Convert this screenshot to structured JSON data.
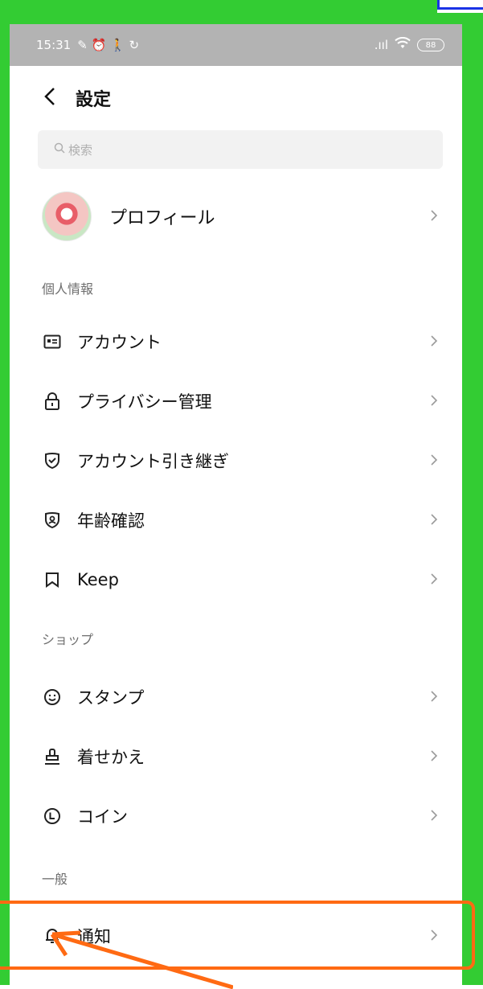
{
  "status_bar": {
    "time": "15:31",
    "left_icons": "✎ ⏰ 🚶 ↻",
    "signal": ".ııl",
    "wifi": "📶",
    "battery": "88"
  },
  "header": {
    "back_label": "<",
    "title": "設定"
  },
  "search": {
    "placeholder": "検索"
  },
  "profile": {
    "label": "プロフィール"
  },
  "sections": {
    "personal": "個人情報",
    "shop": "ショップ",
    "general": "一般"
  },
  "personal_items": [
    {
      "label": "アカウント",
      "icon": "id-card-icon",
      "glyph": "▤"
    },
    {
      "label": "プライバシー管理",
      "icon": "lock-icon",
      "glyph": "🔒"
    },
    {
      "label": "アカウント引き継ぎ",
      "icon": "shield-check-icon",
      "glyph": "🛡"
    },
    {
      "label": "年齢確認",
      "icon": "id-shield-icon",
      "glyph": "◎"
    },
    {
      "label": "Keep",
      "icon": "bookmark-icon",
      "glyph": "⌑"
    }
  ],
  "shop_items": [
    {
      "label": "スタンプ",
      "icon": "smile-icon",
      "glyph": "☺"
    },
    {
      "label": "着せかえ",
      "icon": "brush-icon",
      "glyph": "⚲"
    },
    {
      "label": "コイン",
      "icon": "coin-icon",
      "glyph": "◔"
    }
  ],
  "general_items": [
    {
      "label": "通知",
      "icon": "bell-icon",
      "glyph": "🔔"
    }
  ],
  "colors": {
    "frame": "#33cc33",
    "highlight": "#ff6a13",
    "statusbar": "#b3b3b3"
  }
}
